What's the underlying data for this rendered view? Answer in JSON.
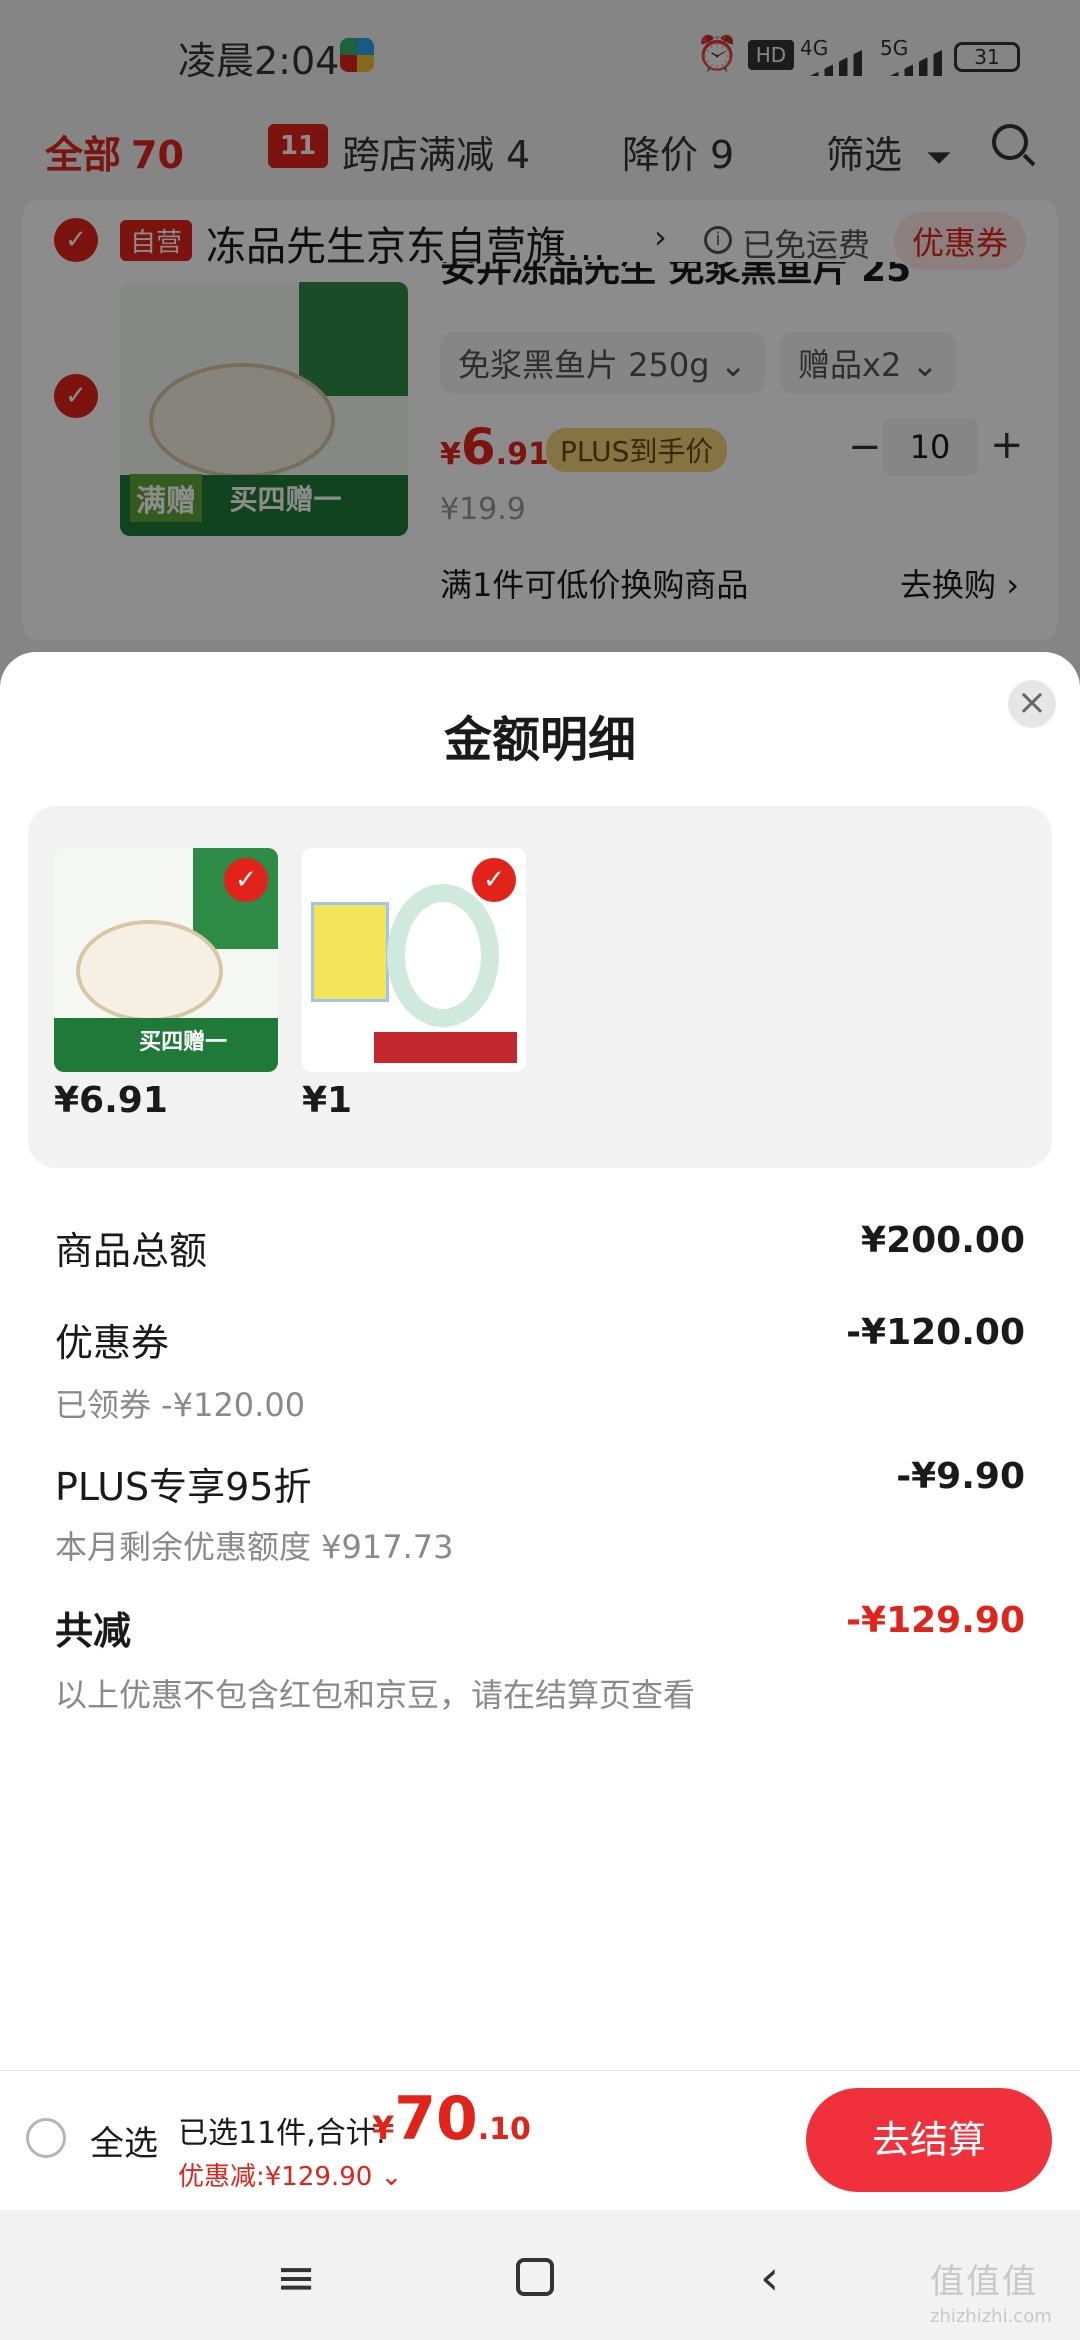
{
  "status_bar": {
    "time": "凌晨2:04",
    "net1": "4G",
    "net2": "5G",
    "battery": "31"
  },
  "filter_bar": {
    "all_label": "全部",
    "all_count": "70",
    "shop_discount_label": "跨店满减",
    "shop_discount_count": "4",
    "price_drop_label": "降价",
    "price_drop_count": "9",
    "filter_label": "筛选"
  },
  "store": {
    "badge": "自营",
    "name": "冻品先生京东自营旗…",
    "shipping": "已免运费",
    "coupon": "优惠券"
  },
  "cart_item": {
    "title": "安井冻品先生 免浆黑鱼片 25",
    "spec": "免浆黑鱼片 250g",
    "gift": "赠品x2",
    "price_int": "6",
    "price_dec": ".91",
    "price_symbol": "¥",
    "plus_tag": "PLUS到手价",
    "original_price": "¥19.9",
    "quantity": "10",
    "promo_text": "满1件可低价换购商品",
    "promo_link": "去换购",
    "img_band": "买四赠一",
    "img_full": "满赠"
  },
  "sheet": {
    "title": "金额明细",
    "thumbnails": [
      {
        "price": "¥6.91",
        "label": "买四赠一"
      },
      {
        "price": "¥1"
      }
    ],
    "rows": {
      "goods_total_label": "商品总额",
      "goods_total_value": "¥200.00",
      "coupon_label": "优惠券",
      "coupon_value": "-¥120.00",
      "coupon_sub": "已领券 -¥120.00",
      "plus_label": "PLUS专享95折",
      "plus_value": "-¥9.90",
      "plus_sub": "本月剩余优惠额度 ¥917.73",
      "total_cut_label": "共减",
      "total_cut_value": "-¥129.90",
      "note": "以上优惠不包含红包和京豆，请在结算页查看"
    }
  },
  "bottom_bar": {
    "select_all": "全选",
    "selected_info": "已选11件,合计:",
    "total_symbol": "¥",
    "total_int": "70",
    "total_dec": ".10",
    "discount": "优惠减:¥129.90",
    "checkout": "去结算"
  },
  "watermark": {
    "text": "值值值",
    "sub": "zhizhizhi.com"
  },
  "colors": {
    "accent": "#e2231a",
    "checkout": "#f0303a",
    "plus_gold": "#f3d27a"
  }
}
